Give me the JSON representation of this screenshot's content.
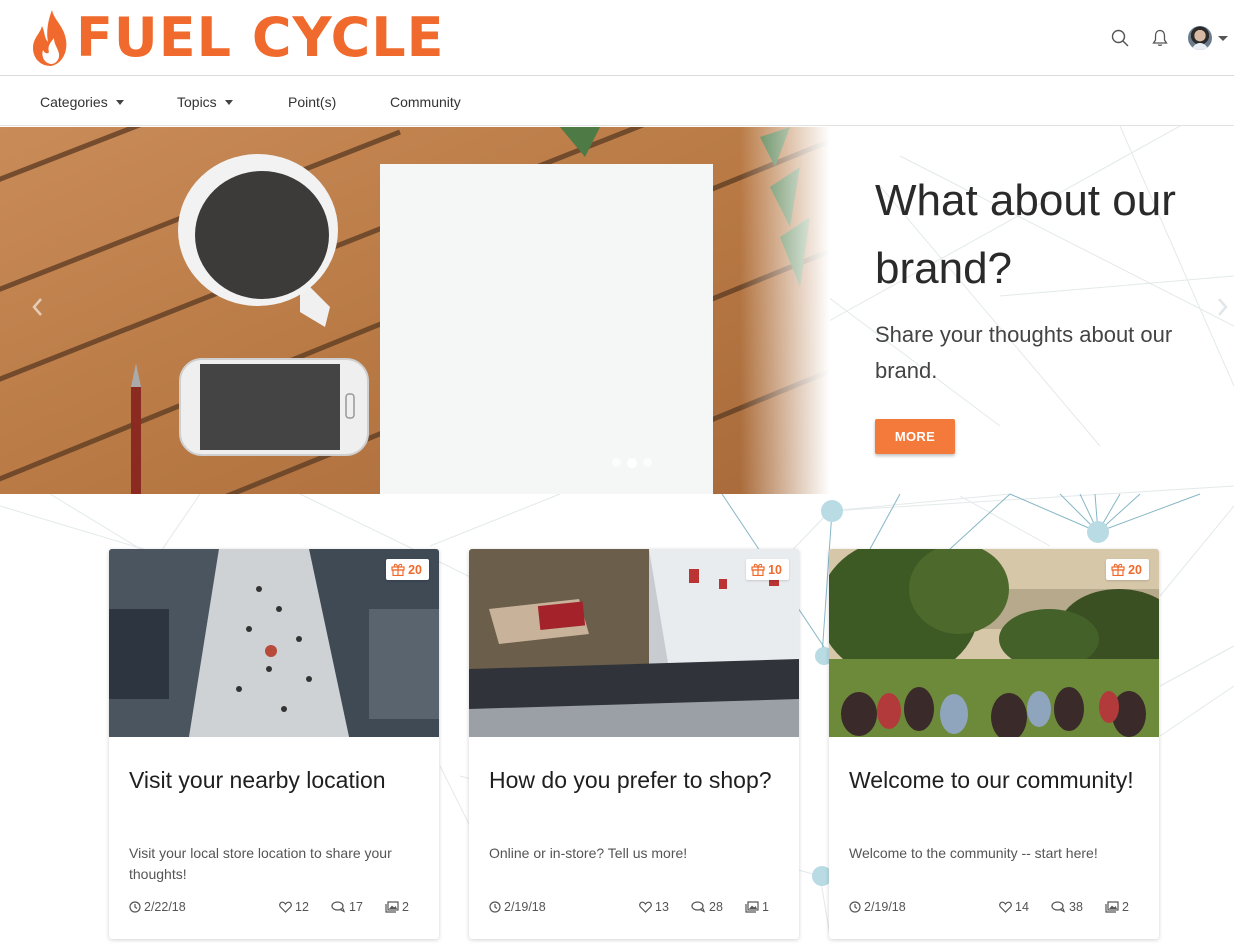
{
  "brand": {
    "name": "FUEL CYCLE",
    "accent_color": "#ef6a2c",
    "button_color": "#f47a3c"
  },
  "header": {
    "icons": [
      "search-icon",
      "bell-icon",
      "user-avatar"
    ]
  },
  "nav": {
    "items": [
      {
        "label": "Categories",
        "has_dropdown": true
      },
      {
        "label": "Topics",
        "has_dropdown": true
      },
      {
        "label": "Point(s)",
        "has_dropdown": false
      },
      {
        "label": "Community",
        "has_dropdown": false
      }
    ]
  },
  "hero": {
    "title": "What about our brand?",
    "subtitle": "Share your thoughts about our brand.",
    "button_label": "MORE",
    "slide_count": 3,
    "active_slide": 2
  },
  "cards": [
    {
      "points": "20",
      "title": "Visit your nearby location",
      "description": "Visit your local store location to share your thoughts!",
      "date": "2/22/18",
      "likes": "12",
      "comments": "17",
      "images": "2"
    },
    {
      "points": "10",
      "title": "How do you prefer to shop?",
      "description": "Online or in-store? Tell us more!",
      "date": "2/19/18",
      "likes": "13",
      "comments": "28",
      "images": "1"
    },
    {
      "points": "20",
      "title": "Welcome to our community!",
      "description": "Welcome to the community -- start here!",
      "date": "2/19/18",
      "likes": "14",
      "comments": "38",
      "images": "2"
    }
  ]
}
